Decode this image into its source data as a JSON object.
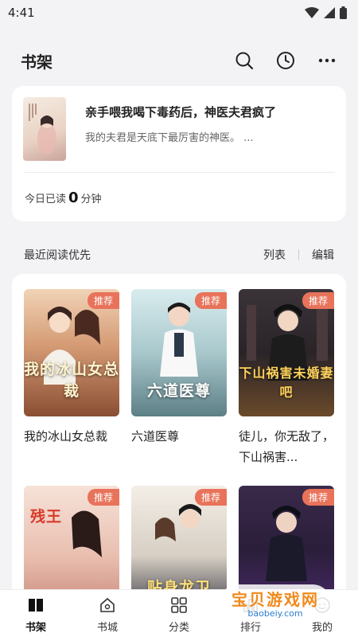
{
  "status_bar": {
    "time": "4:41"
  },
  "header": {
    "title": "书架",
    "icons": [
      "search-icon",
      "history-icon",
      "more-icon"
    ]
  },
  "recent": {
    "book_title": "亲手喂我喝下毒药后，神医夫君疯了",
    "description": "我的夫君是天底下最厉害的神医。 ...",
    "today_prefix": "今日已读",
    "today_minutes": "0",
    "today_suffix": "分钟"
  },
  "section": {
    "label": "最近阅读优先",
    "list_label": "列表",
    "edit_label": "编辑"
  },
  "books": [
    {
      "name": "我的冰山女总裁",
      "cover_title": "我的冰山女总裁",
      "badge": "推荐"
    },
    {
      "name": "六道医尊",
      "cover_title": "六道医尊",
      "badge": "推荐"
    },
    {
      "name": "徒儿，你无敌了，下山祸害...",
      "cover_title": "下山祸害未婚妻吧",
      "badge": "推荐"
    },
    {
      "name": "",
      "cover_title": "残王",
      "badge": "推荐"
    },
    {
      "name": "",
      "cover_title": "贴身龙卫",
      "badge": "推荐"
    },
    {
      "name": "",
      "cover_title": "",
      "badge": "推荐"
    }
  ],
  "watermark": {
    "line1": "宝贝游戏网",
    "line2": "baobeiy.com"
  },
  "tabs": [
    {
      "label": "书架",
      "icon": "bookshelf-icon"
    },
    {
      "label": "书城",
      "icon": "bookstore-icon"
    },
    {
      "label": "分类",
      "icon": "category-icon"
    },
    {
      "label": "排行",
      "icon": "ranking-icon"
    },
    {
      "label": "我的",
      "icon": "profile-icon"
    }
  ],
  "colors": {
    "accent": "#e8735a",
    "background": "#f3f3f5"
  }
}
